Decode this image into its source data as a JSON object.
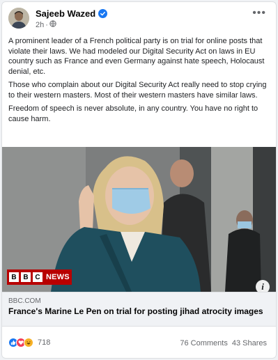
{
  "post": {
    "author": "Sajeeb Wazed",
    "time": "2h",
    "paragraphs": [
      "A prominent leader of a French political party is on trial for online posts that violate their laws. We had modeled our Digital Security Act on laws in EU country such as France and even Germany against hate speech, Holocaust denial, etc.",
      "Those who complain about our Digital Security Act really need to stop crying to their western masters. Most of their western masters have similar laws.",
      "Freedom of speech is never absolute, in any country. You have no right to cause harm."
    ]
  },
  "photo": {
    "bbc_logo_text": "BBC",
    "news_label": "NEWS"
  },
  "link": {
    "domain": "BBC.COM",
    "title": "France's Marine Le Pen on trial for posting jihad atrocity images"
  },
  "engagement": {
    "reactions_count": "718",
    "comments": "76 Comments",
    "shares": "43 Shares"
  },
  "icons": [
    "verified-badge-icon",
    "globe-icon",
    "more-options-icon",
    "info-icon",
    "like-reaction-icon",
    "love-reaction-icon",
    "haha-reaction-icon"
  ],
  "colors": {
    "facebook_blue": "#1877f2",
    "bbc_red": "#b80000",
    "love_red": "#f33e58",
    "haha_yellow": "#f7b125"
  }
}
